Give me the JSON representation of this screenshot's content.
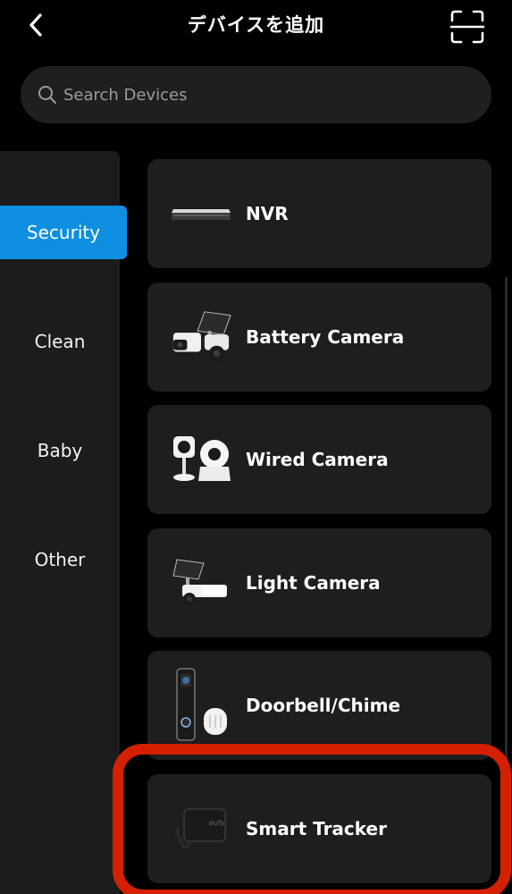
{
  "header": {
    "title": "デバイスを追加",
    "back_icon": "chevron-left-icon",
    "scan_icon": "scan-icon"
  },
  "search": {
    "placeholder": "Search Devices",
    "value": "",
    "icon": "search-icon"
  },
  "sidebar": {
    "items": [
      {
        "label": "Security",
        "active": true
      },
      {
        "label": "Clean",
        "active": false
      },
      {
        "label": "Baby",
        "active": false
      },
      {
        "label": "Other",
        "active": false
      }
    ]
  },
  "devices": [
    {
      "label": "NVR",
      "icon": "nvr-icon"
    },
    {
      "label": "Battery Camera",
      "icon": "battery-camera-icon"
    },
    {
      "label": "Wired Camera",
      "icon": "wired-camera-icon"
    },
    {
      "label": "Light Camera",
      "icon": "light-camera-icon"
    },
    {
      "label": "Doorbell/Chime",
      "icon": "doorbell-icon"
    },
    {
      "label": "Smart Tracker",
      "icon": "smart-tracker-icon"
    }
  ],
  "tracker_brand": "eufy",
  "colors": {
    "background": "#000000",
    "card": "#1e1e1e",
    "accent": "#0f8fe1",
    "highlight": "#d32000"
  }
}
